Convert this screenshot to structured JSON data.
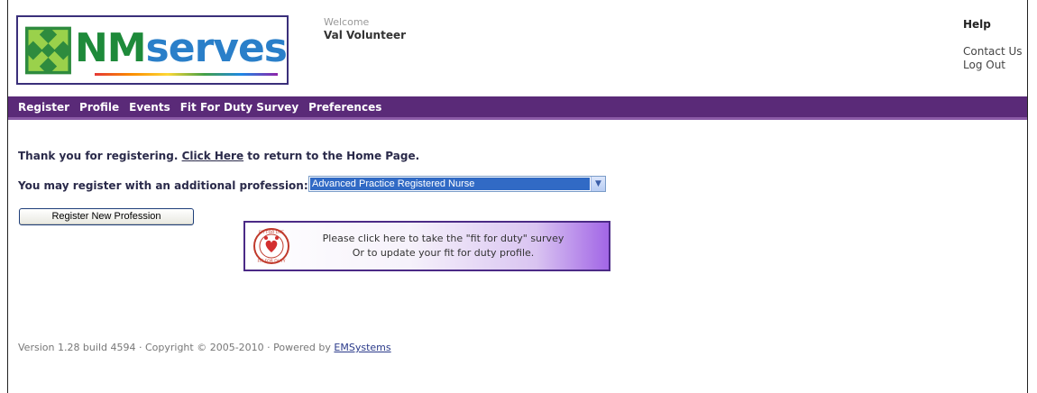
{
  "header": {
    "logo_text_nm": "NM",
    "logo_text_serves": "serves",
    "welcome_label": "Welcome",
    "user_name": "Val Volunteer",
    "help_label": "Help",
    "contact_label": "Contact Us",
    "logout_label": "Log Out"
  },
  "nav": {
    "items": [
      {
        "label": "Register"
      },
      {
        "label": "Profile"
      },
      {
        "label": "Events"
      },
      {
        "label": "Fit For Duty Survey"
      },
      {
        "label": "Preferences"
      }
    ]
  },
  "main": {
    "thanks_prefix": "Thank you for registering.",
    "home_link": "Click Here",
    "thanks_suffix": "to return to the Home Page.",
    "profession_label": "You may register with an additional profession:",
    "profession_selected": "Advanced Practice Registered Nurse",
    "register_button": "Register New Profession",
    "fit_line1": "Please click here to take the \"fit for duty\" survey",
    "fit_line2": "Or to update your fit for duty profile.",
    "fit_badge_top": "FIT FOR LIFE",
    "fit_badge_bottom": "FIT FOR DUTY"
  },
  "footer": {
    "text": "Version 1.28 build 4594 · Copyright © 2005-2010 · Powered by",
    "link": "EMSystems"
  },
  "colors": {
    "nav_bg": "#5a2a78",
    "logo_green": "#1e8a3a",
    "logo_blue": "#2a7fc9",
    "select_highlight": "#316ac5"
  }
}
